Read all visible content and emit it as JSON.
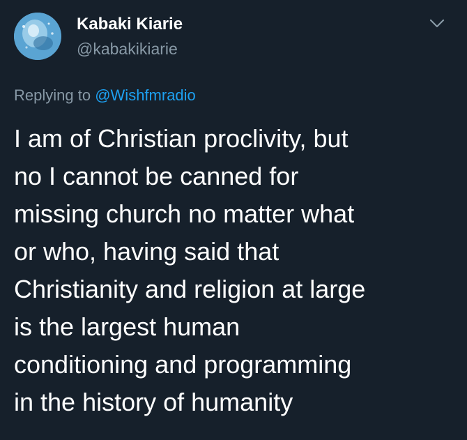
{
  "user": {
    "display_name": "Kabaki Kiarie",
    "handle": "@kabakikiarie",
    "avatar_icon": "avatar-image"
  },
  "menu": {
    "icon": "chevron-down-icon"
  },
  "reply": {
    "prefix": "Replying to",
    "mention": "@Wishfmradio"
  },
  "tweet": {
    "text": "I am of Christian proclivity,  but\nno I cannot be canned for\nmissing church no matter what\nor who, having said that\nChristianity and religion at large\nis the largest human\nconditioning and programming\nin the history of humanity"
  },
  "colors": {
    "background": "#16202b",
    "primary_text": "#ffffff",
    "secondary_text": "#8899a6",
    "link": "#1da1f2"
  }
}
